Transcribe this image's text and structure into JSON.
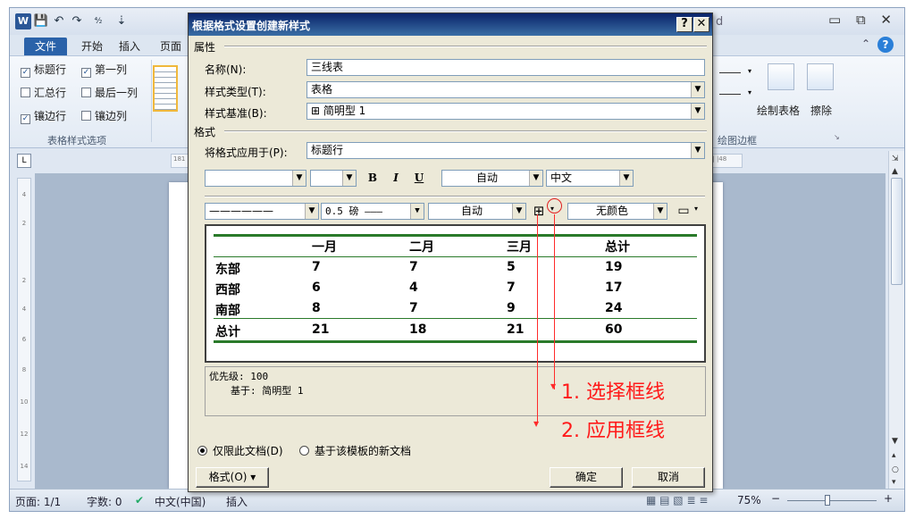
{
  "word": {
    "title_suffix": "d",
    "quick_access": [
      "W",
      "💾",
      "↶",
      "↷",
      "⁴⁄₂",
      "⇣"
    ],
    "window_controls": "▭ ⧉ ✕",
    "tabs": {
      "file": "文件",
      "home": "开始",
      "insert": "插入",
      "page": "页面"
    },
    "ribbon_min_icon": "⌃",
    "help_icon": "?",
    "style_options": {
      "header_row": "标题行",
      "first_column": "第一列",
      "total_row": "汇总行",
      "last_column": "最后一列",
      "banded_rows": "镶边行",
      "banded_columns": "镶边列",
      "group_label": "表格样式选项"
    },
    "draw_borders": {
      "draw_table": "绘制表格",
      "erase": "擦除",
      "group_label": "绘图边框",
      "dialog_launcher": "↘"
    },
    "ruler_corner": "L",
    "ruler_marks_left": [
      "4",
      "2",
      "",
      "2",
      "4",
      "6",
      "8",
      "10",
      "12",
      "14"
    ],
    "top_ruler_left": "181",
    "top_ruler_right": "146| |48",
    "status": {
      "page": "页面: 1/1",
      "words": "字数: 0",
      "lang": "中文(中国)",
      "mode": "插入",
      "zoom": "75%",
      "zoom_minus": "−",
      "zoom_plus": "+"
    }
  },
  "dialog": {
    "title": "根据格式设置创建新样式",
    "help_btn": "?",
    "close_btn": "✕",
    "properties": {
      "section": "属性",
      "name_label": "名称(N):",
      "name_value": "三线表",
      "type_label": "样式类型(T):",
      "type_value": "表格",
      "based_label": "样式基准(B):",
      "based_value": "⊞ 简明型 1"
    },
    "format": {
      "section": "格式",
      "apply_label": "将格式应用于(P):",
      "apply_value": "标题行",
      "font_name": "",
      "font_size": "",
      "bold": "B",
      "italic": "I",
      "underline": "U",
      "font_color": "自动",
      "script": "中文",
      "line_style": "——————",
      "line_weight": "0.5 磅 ———",
      "border_color": "自动",
      "border_icon": "⊞",
      "shading": "无颜色",
      "align_icon": "▭"
    },
    "preview": {
      "headers": [
        "",
        "一月",
        "二月",
        "三月",
        "总计"
      ],
      "rows": [
        [
          "东部",
          "7",
          "7",
          "5",
          "19"
        ],
        [
          "西部",
          "6",
          "4",
          "7",
          "17"
        ],
        [
          "南部",
          "8",
          "7",
          "9",
          "24"
        ],
        [
          "总计",
          "21",
          "18",
          "21",
          "60"
        ]
      ]
    },
    "description": {
      "line1": "优先级: 100",
      "line2": "基于: 简明型 1"
    },
    "scope": {
      "only_doc": "仅限此文档(D)",
      "template": "基于该模板的新文档"
    },
    "buttons": {
      "format": "格式(O) ▾",
      "ok": "确定",
      "cancel": "取消"
    }
  },
  "annotations": {
    "step1": "1. 选择框线",
    "step2": "2. 应用框线",
    "color": "#ff1a1a"
  }
}
